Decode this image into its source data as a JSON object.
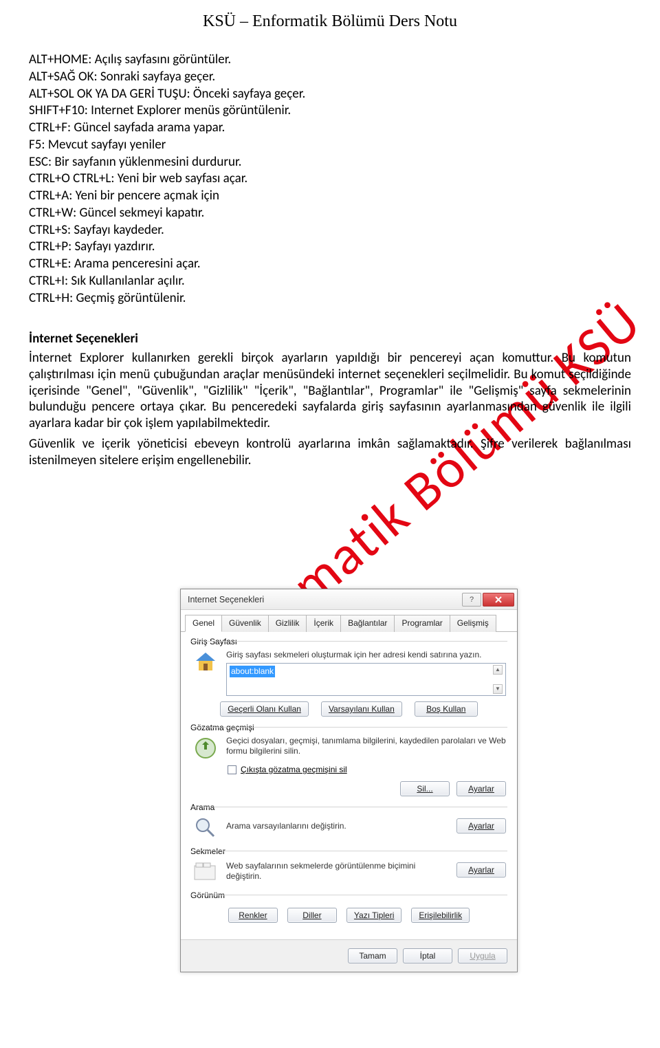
{
  "header": {
    "title": "KSÜ – Enformatik Bölümü Ders Notu"
  },
  "watermark": "Enformatik Bölümü KSÜ",
  "shortcuts": {
    "l1": "ALT+HOME: Açılış sayfasını görüntüler.",
    "l2": "ALT+SAĞ OK: Sonraki sayfaya geçer.",
    "l3": "ALT+SOL OK YA DA GERİ TUŞU: Önceki sayfaya geçer.",
    "l4": "SHIFT+F10: Internet Explorer menüs görüntülenir.",
    "l5": "CTRL+F: Güncel sayfada arama yapar.",
    "l6": "F5: Mevcut sayfayı yeniler",
    "l7": "ESC: Bir sayfanın yüklenmesini durdurur.",
    "l8": "CTRL+O  CTRL+L: Yeni bir web sayfası açar.",
    "l9": "CTRL+A: Yeni bir pencere açmak için",
    "l10": "CTRL+W: Güncel sekmeyi kapatır.",
    "l11": "CTRL+S: Sayfayı kaydeder.",
    "l12": "CTRL+P: Sayfayı yazdırır.",
    "l13": "CTRL+E: Arama penceresini açar.",
    "l14": "CTRL+I: Sık Kullanılanlar açılır.",
    "l15": "CTRL+H: Geçmiş görüntülenir."
  },
  "section": {
    "title": "İnternet Seçenekleri",
    "p1": "İnternet Explorer kullanırken gerekli birçok ayarların yapıldığı bir pencereyi açan komuttur. Bu komutun çalıştırılması için menü çubuğundan araçlar menüsündeki internet seçenekleri seçilmelidir. Bu komut seçildiğinde içerisinde \"Genel\", \"Güvenlik\", \"Gizlilik\" \"İçerik\", \"Bağlantılar\", Programlar\" ile \"Gelişmiş\" sayfa sekmelerinin bulunduğu pencere ortaya çıkar. Bu penceredeki sayfalarda giriş sayfasının ayarlanmasından güvenlik ile ilgili ayarlara kadar bir çok işlem yapılabilmektedir.",
    "p2": "Güvenlik ve içerik yöneticisi ebeveyn kontrolü ayarlarına imkân sağlamaktadır. Şifre verilerek bağlanılması istenilmeyen sitelere erişim engellenebilir."
  },
  "dialog": {
    "title": "Internet Seçenekleri",
    "tabs": {
      "genel": "Genel",
      "guvenlik": "Güvenlik",
      "gizlilik": "Gizlilik",
      "icerik": "İçerik",
      "baglantilar": "Bağlantılar",
      "programlar": "Programlar",
      "gelismis": "Gelişmiş"
    },
    "giris": {
      "label": "Giriş Sayfası",
      "desc": "Giriş sayfası sekmeleri oluşturmak için her adresi kendi satırına yazın.",
      "value": "about:blank",
      "btn1": "Geçerli Olanı Kullan",
      "btn2": "Varsayılanı Kullan",
      "btn3": "Boş Kullan"
    },
    "gozatma": {
      "label": "Gözatma geçmişi",
      "desc": "Geçici dosyaları, geçmişi, tanımlama bilgilerini, kaydedilen parolaları ve Web formu bilgilerini silin.",
      "check": "Çıkışta gözatma geçmişini sil",
      "btn_sil": "Sil...",
      "btn_ayarlar": "Ayarlar"
    },
    "arama": {
      "label": "Arama",
      "desc": "Arama varsayılanlarını değiştirin.",
      "btn": "Ayarlar"
    },
    "sekmeler": {
      "label": "Sekmeler",
      "desc": "Web sayfalarının sekmelerde görüntülenme biçimini değiştirin.",
      "btn": "Ayarlar"
    },
    "gorunum": {
      "label": "Görünüm",
      "btn_renkler": "Renkler",
      "btn_diller": "Diller",
      "btn_yazi": "Yazı Tipleri",
      "btn_eris": "Erişilebilirlik"
    },
    "bottom": {
      "tamam": "Tamam",
      "iptal": "İptal",
      "uygula": "Uygula"
    }
  }
}
